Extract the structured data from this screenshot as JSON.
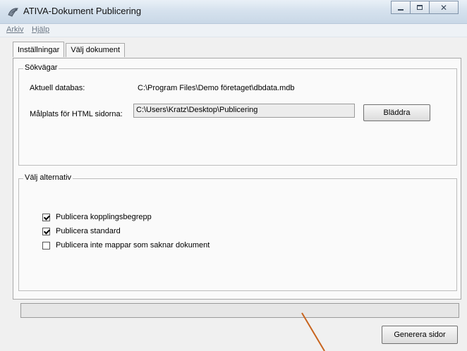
{
  "window": {
    "title": "ATIVA-Dokument Publicering",
    "icon": "satellite-dish-icon",
    "controls": [
      "minimize",
      "maximize",
      "close"
    ]
  },
  "menu": {
    "arkiv": "Arkiv",
    "hjalp": "Hjälp"
  },
  "tabs": [
    {
      "label": "Inställningar",
      "active": true
    },
    {
      "label": "Välj dokument",
      "active": false
    }
  ],
  "paths_group": {
    "title": "Sökvägar",
    "db_label": "Aktuell databas:",
    "db_value": "C:\\Program Files\\Demo företaget\\dbdata.mdb",
    "target_label": "Målplats för HTML sidorna:",
    "target_value": "C:\\Users\\Kratz\\Desktop\\Publicering",
    "browse_button": "Bläddra"
  },
  "options_group": {
    "title": "Välj alternativ",
    "options": [
      {
        "label": "Publicera kopplingsbegrepp",
        "checked": true
      },
      {
        "label": "Publicera standard",
        "checked": true
      },
      {
        "label": "Publicera inte mappar som saknar dokument",
        "checked": false
      }
    ]
  },
  "progress": {
    "value": 0
  },
  "generate_button": "Generera sidor",
  "colors": {
    "annotation_arrow": "#c8641e"
  }
}
